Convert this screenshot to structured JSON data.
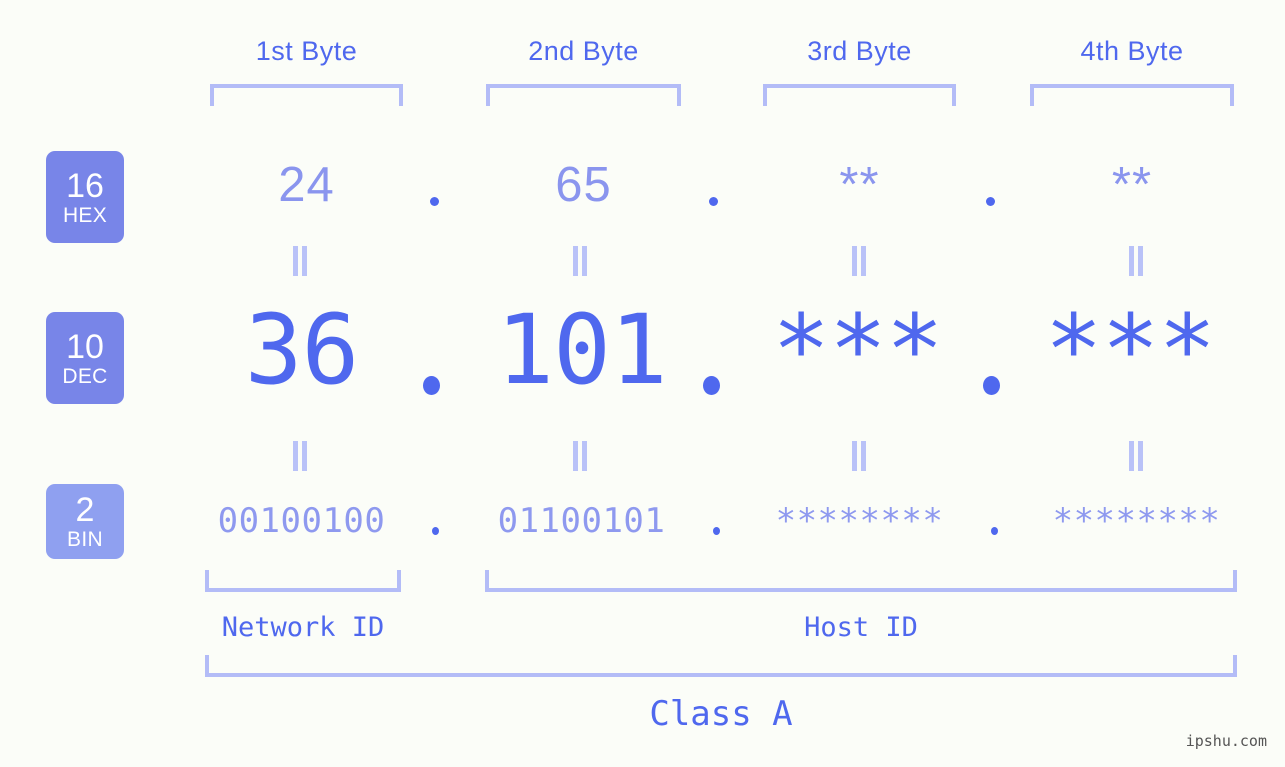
{
  "page": {
    "background_color": "#fbfdf8",
    "accent_color": "#4f68ee",
    "light_accent_color": "#b3bcf7",
    "watermark": "ipshu.com"
  },
  "byte_headers": [
    {
      "label": "1st Byte"
    },
    {
      "label": "2nd Byte"
    },
    {
      "label": "3rd Byte"
    },
    {
      "label": "4th Byte"
    }
  ],
  "rows": [
    {
      "badge_number": "16",
      "badge_name": "HEX",
      "badge_color": "#7885e8",
      "values": [
        "24",
        "65",
        "**",
        "**"
      ],
      "separator": "."
    },
    {
      "badge_number": "10",
      "badge_name": "DEC",
      "badge_color": "#7885e8",
      "values": [
        "36",
        "101",
        "***",
        "***"
      ],
      "separator": "."
    },
    {
      "badge_number": "2",
      "badge_name": "BIN",
      "badge_color": "#8fa0f0",
      "values": [
        "00100100",
        "01100101",
        "********",
        "********"
      ],
      "separator": "."
    }
  ],
  "equals_marks": {
    "glyph": "||",
    "count_per_gap": 4
  },
  "id_labels": [
    {
      "label": "Network ID"
    },
    {
      "label": "Host ID"
    }
  ],
  "class_label": "Class A"
}
